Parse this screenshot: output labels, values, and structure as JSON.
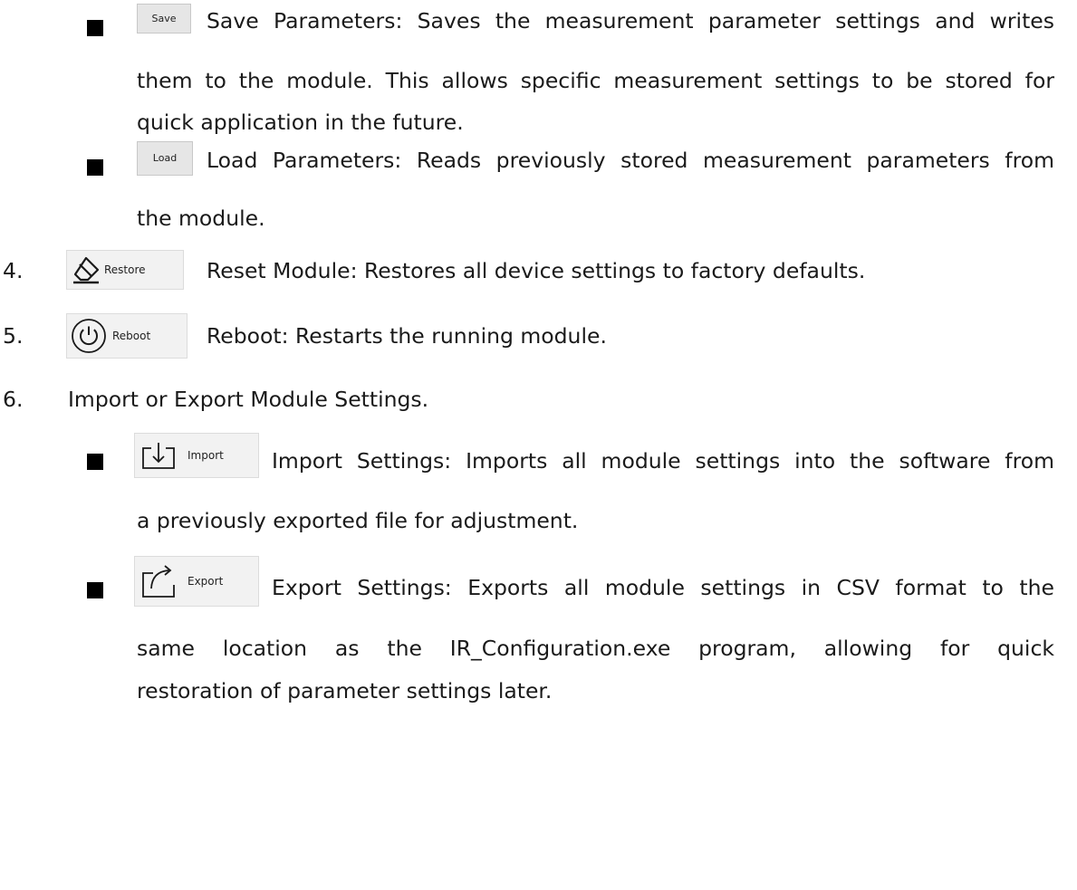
{
  "items": {
    "save": {
      "button_label": "Save",
      "line1": "Save Parameters: Saves the measurement parameter settings and writes",
      "line2": "them to the module. This allows specific measurement settings to be stored for",
      "line3": "quick application in the future."
    },
    "load": {
      "button_label": "Load",
      "line1": "Load Parameters: Reads previously stored measurement parameters from",
      "line2": "the module."
    },
    "restore": {
      "number": "4.",
      "button_label": "Restore",
      "icon": "eraser-icon",
      "text": "Reset Module: Restores all device settings to factory defaults."
    },
    "reboot": {
      "number": "5.",
      "button_label": "Reboot",
      "icon": "power-icon",
      "text": "Reboot: Restarts the running module."
    },
    "import_export": {
      "number": "6.",
      "text": "Import or Export Module Settings."
    },
    "import": {
      "button_label": "Import",
      "icon": "import-icon",
      "line1": "Import Settings: Imports all module settings into the software from",
      "line2": "a previously exported file for adjustment."
    },
    "export": {
      "button_label": "Export",
      "icon": "export-icon",
      "line1": "Export Settings: Exports all module settings in CSV format to the",
      "line2": "same location as the IR_Configuration.exe program, allowing for quick",
      "line3": "restoration of parameter settings later."
    }
  }
}
